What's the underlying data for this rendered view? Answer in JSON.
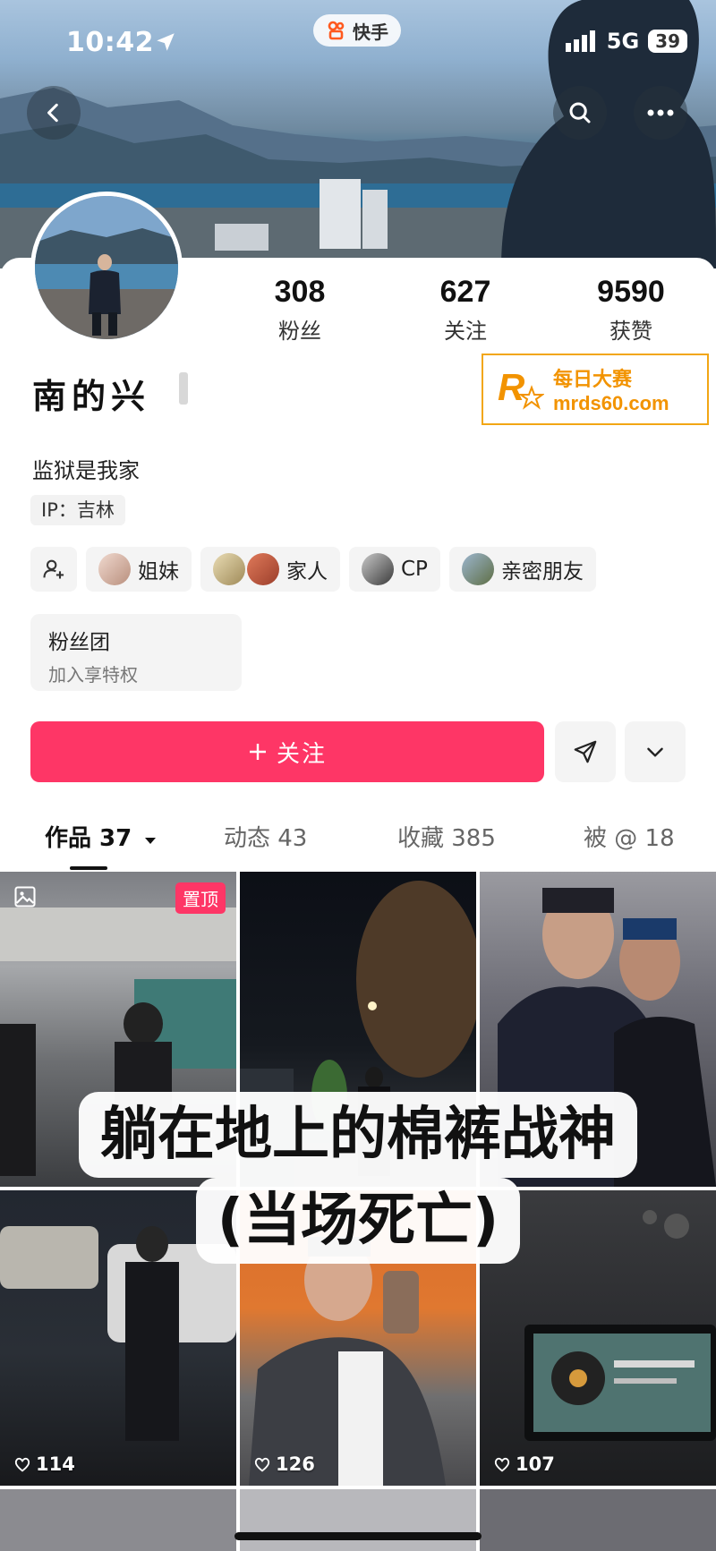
{
  "status_bar": {
    "time": "10:42",
    "network": "5G",
    "battery": "39"
  },
  "app_pill": {
    "label": "快手",
    "icon": "kuaishou-logo-icon"
  },
  "header": {
    "back_icon": "back-arrow-icon",
    "search_icon": "search-icon",
    "more_icon": "more-dots-icon"
  },
  "profile": {
    "stats": [
      {
        "value": "308",
        "label": "粉丝"
      },
      {
        "value": "627",
        "label": "关注"
      },
      {
        "value": "9590",
        "label": "获赞"
      }
    ],
    "name": "南的兴",
    "bio": "监狱是我家",
    "ip": "IP：吉林"
  },
  "watermark": {
    "line1": "每日大赛",
    "line2": "mrds60.com"
  },
  "relations": [
    {
      "label": "姐妹"
    },
    {
      "label": "家人"
    },
    {
      "label": "CP"
    },
    {
      "label": "亲密朋友"
    }
  ],
  "fan_group": {
    "title": "粉丝团",
    "subtitle": "加入享特权"
  },
  "actions": {
    "follow": "关注",
    "follow_icon": "plus-icon",
    "share_icon": "paper-plane-icon",
    "expand_icon": "chevron-down-icon"
  },
  "tabs": [
    {
      "label": "作品 37"
    },
    {
      "label": "动态 43"
    },
    {
      "label": "收藏 385"
    },
    {
      "label": "被 @ 18"
    }
  ],
  "grid": {
    "pin_badge": "置顶",
    "likes": [
      "114",
      "126",
      "107"
    ]
  },
  "caption": {
    "line1": "躺在地上的棉裤战神",
    "line2": "(当场死亡)"
  },
  "colors": {
    "accent": "#fe3666",
    "watermark": "#f29300"
  }
}
